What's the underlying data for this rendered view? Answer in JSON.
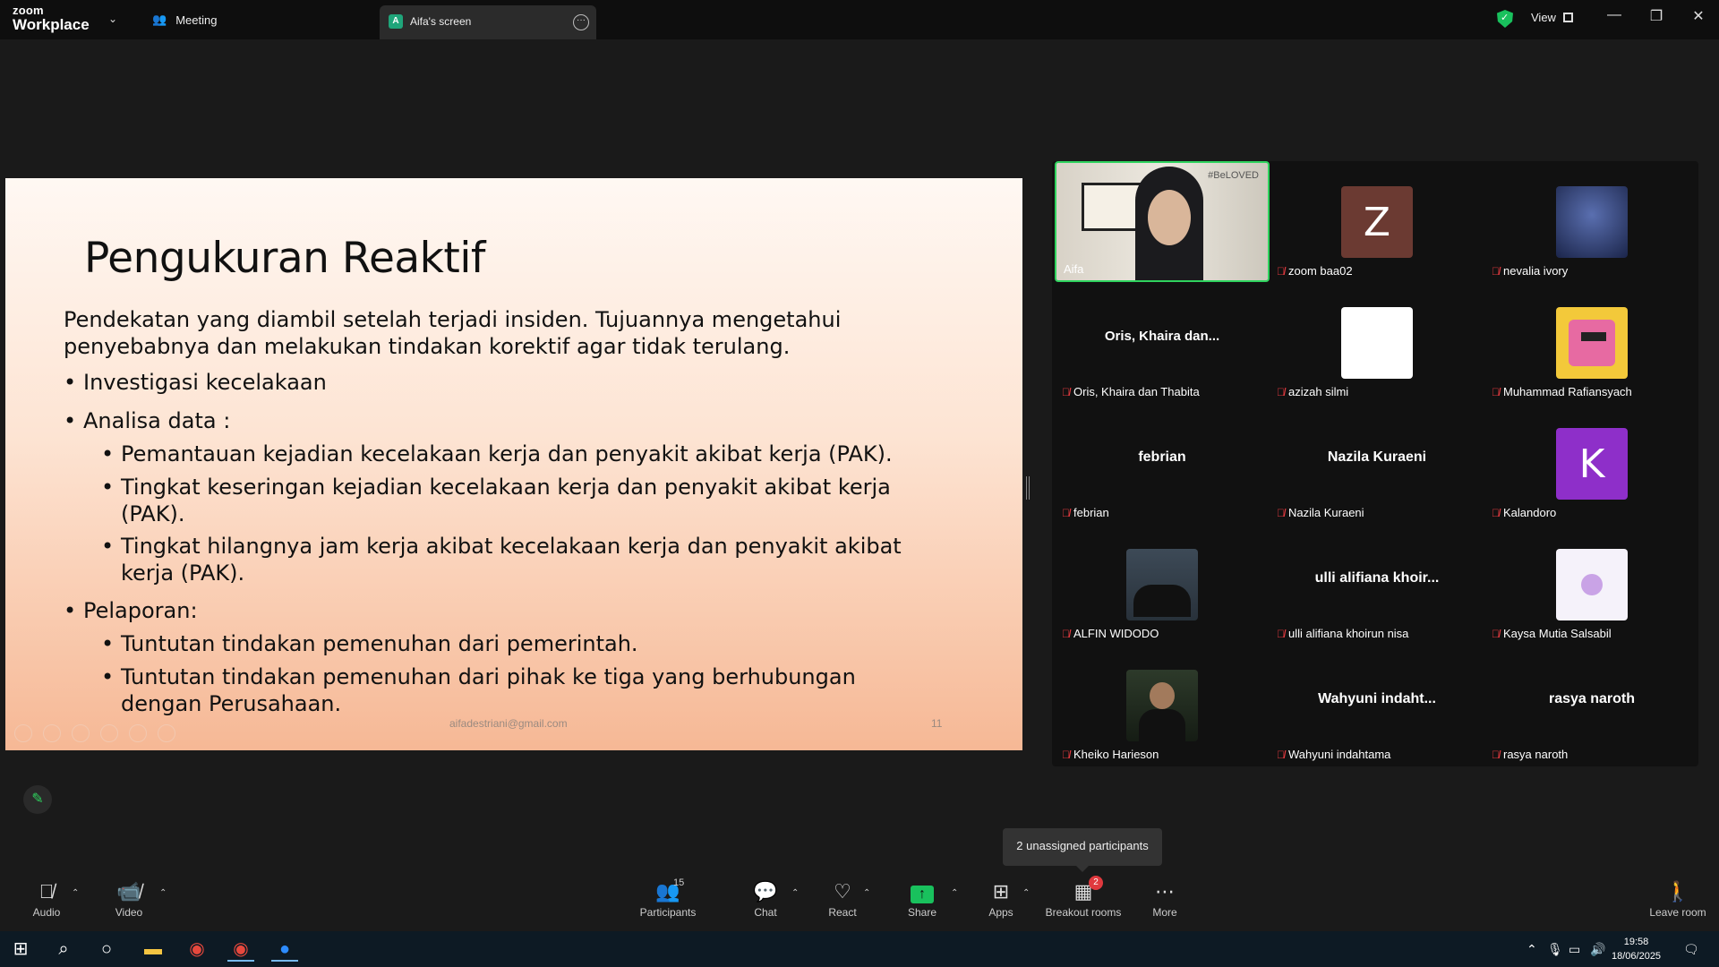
{
  "titlebar": {
    "logo_line1": "zoom",
    "logo_line2": "Workplace",
    "meeting_tab": "Meeting",
    "share_tab_badge": "A",
    "share_tab": "Aifa's screen",
    "view_label": "View"
  },
  "slide": {
    "title": "Pengukuran Reaktif",
    "intro_line1": "Pendekatan yang diambil setelah terjadi insiden. Tujuannya mengetahui",
    "intro_line2": "penyebabnya  dan melakukan tindakan korektif agar tidak terulang.",
    "bullets": [
      "Investigasi kecelakaan",
      "Analisa data :",
      "Pelaporan:"
    ],
    "analisa_items": [
      "Pemantauan kejadian kecelakaan kerja dan penyakit akibat kerja (PAK).",
      "Tingkat keseringan kejadian kecelakaan kerja dan penyakit akibat kerja",
      "(PAK).",
      "Tingkat hilangnya jam kerja akibat kecelakaan kerja dan penyakit akibat",
      "kerja (PAK)."
    ],
    "pelaporan_items": [
      "Tuntutan tindakan pemenuhan dari pemerintah.",
      "Tuntutan tindakan pemenuhan dari pihak ke tiga yang berhubungan",
      "dengan Perusahaan."
    ],
    "footer_email": "aifadestriani@gmail.com",
    "footer_page": "11"
  },
  "participants": [
    {
      "name": "Aifa",
      "label": "",
      "type": "video"
    },
    {
      "name": "zoom baa02",
      "label": "Z",
      "type": "letter",
      "color": "#6b3a32"
    },
    {
      "name": "nevalia ivory",
      "label": "",
      "type": "photo",
      "color": "#2b3b6a"
    },
    {
      "name": "Oris, Khaira dan Thabita",
      "label": "Oris, Khaira dan...",
      "type": "text"
    },
    {
      "name": "azizah silmi",
      "label": "",
      "type": "photo",
      "color": "#ffffff"
    },
    {
      "name": "Muhammad Rafiansyach",
      "label": "",
      "type": "photo",
      "color": "#f3c93a"
    },
    {
      "name": "febrian",
      "label": "febrian",
      "type": "text"
    },
    {
      "name": "Nazila Kuraeni",
      "label": "Nazila Kuraeni",
      "type": "text"
    },
    {
      "name": "Kalandoro",
      "label": "K",
      "type": "letter",
      "color": "#8e2fc9"
    },
    {
      "name": "ALFIN WIDODO",
      "label": "",
      "type": "photo",
      "color": "#3d4a57"
    },
    {
      "name": "ulli alifiana khoirun nisa",
      "label": "ulli alifiana khoir...",
      "type": "text"
    },
    {
      "name": "Kaysa Mutia Salsabil",
      "label": "",
      "type": "photo",
      "color": "#f5f2fa"
    },
    {
      "name": "Kheiko Harieson",
      "label": "",
      "type": "photo",
      "color": "#2d3a2a"
    },
    {
      "name": "Wahyuni indahtama",
      "label": "Wahyuni indaht...",
      "type": "text"
    },
    {
      "name": "rasya naroth",
      "label": "rasya naroth",
      "type": "text"
    }
  ],
  "video_overlay": "#BeLOVED",
  "tooltip": "2 unassigned participants",
  "toolbar": {
    "audio": "Audio",
    "video": "Video",
    "participants": "Participants",
    "participants_count": "15",
    "chat": "Chat",
    "react": "React",
    "share": "Share",
    "apps": "Apps",
    "breakout": "Breakout rooms",
    "breakout_badge": "2",
    "more": "More",
    "leave": "Leave room"
  },
  "taskbar": {
    "time": "19:58",
    "date": "18/06/2025"
  },
  "colors": {
    "accent_green": "#2fd35e",
    "mute_red": "#e0393e"
  }
}
